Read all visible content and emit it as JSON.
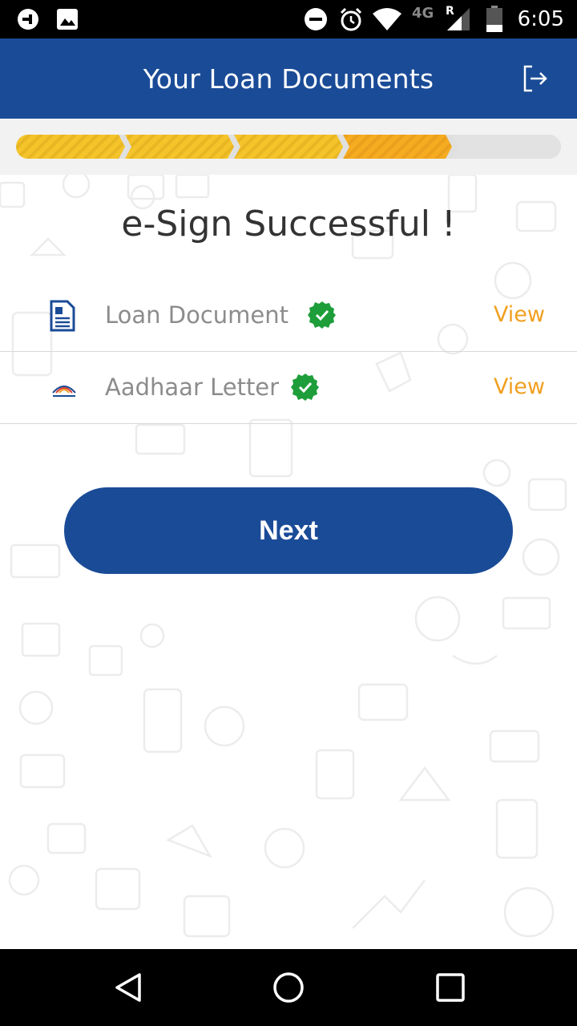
{
  "status_bar": {
    "time": "6:05",
    "network": "4G",
    "roaming": "R",
    "icons": [
      "app-notification-icon",
      "image-icon",
      "do-not-disturb-icon",
      "alarm-icon",
      "wifi-icon",
      "signal-icon",
      "battery-icon"
    ]
  },
  "header": {
    "title": "Your Loan Documents",
    "logout_icon": "logout-icon"
  },
  "progress": {
    "steps_total": 5,
    "steps_completed": 4,
    "colors": [
      "#f5c42a",
      "#f5c42a",
      "#f5c42a",
      "#f5ac20"
    ],
    "track_color": "#e0e0e0"
  },
  "main": {
    "heading": "e-Sign Successful !",
    "documents": [
      {
        "label": "Loan Document",
        "status": "signed",
        "action": "View",
        "icon": "document-icon"
      },
      {
        "label": "Aadhaar Letter",
        "status": "signed",
        "action": "View",
        "icon": "aadhaar-logo-icon"
      }
    ],
    "next_button": "Next"
  },
  "colors": {
    "primary": "#1a4b97",
    "accent": "#f0a020",
    "success": "#1e9e3a"
  }
}
